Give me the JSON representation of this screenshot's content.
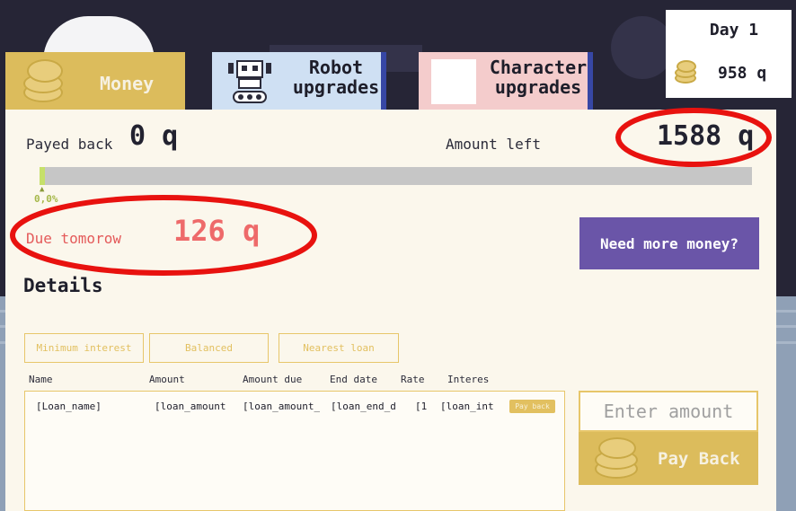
{
  "tabs": [
    {
      "label": "Money",
      "icon": "coins-icon",
      "color": "#dcbc5c"
    },
    {
      "label": "Robot upgrades",
      "icon": "robot-icon",
      "color": "#cfe0f3"
    },
    {
      "label": "Character upgrades",
      "icon": "character-icon",
      "color": "#f4cccc"
    }
  ],
  "status": {
    "day": "Day 1",
    "cash": "958 q"
  },
  "summary": {
    "payed_back_label": "Payed back",
    "payed_back_value": "0 q",
    "amount_left_label": "Amount left",
    "amount_left_value": "1588 q",
    "progress_percent": "0,0%",
    "progress_fraction": 0.0,
    "due_label": "Due tomorow",
    "due_value": "126 q"
  },
  "need_money_button": "Need more money?",
  "details_title": "Details",
  "sort_options": [
    "Minimum interest",
    "Balanced",
    "Nearest loan"
  ],
  "table": {
    "columns": [
      "Name",
      "Amount",
      "Amount due",
      "End date",
      "Rate",
      "Interes"
    ],
    "rows": [
      {
        "name": "[Loan_name]",
        "amount": "[loan_amount",
        "amount_due": "[loan_amount_",
        "end_date": "[loan_end_d",
        "rate": "[1",
        "interest": "[loan_int",
        "action": "Pay back"
      }
    ]
  },
  "payback": {
    "input_placeholder": "Enter amount",
    "button_label": "Pay Back"
  },
  "colors": {
    "accent_gold": "#dcbc5c",
    "due_red": "#ee6a6a",
    "purple_button": "#6a55a8",
    "annotation_red": "#e8120f"
  }
}
